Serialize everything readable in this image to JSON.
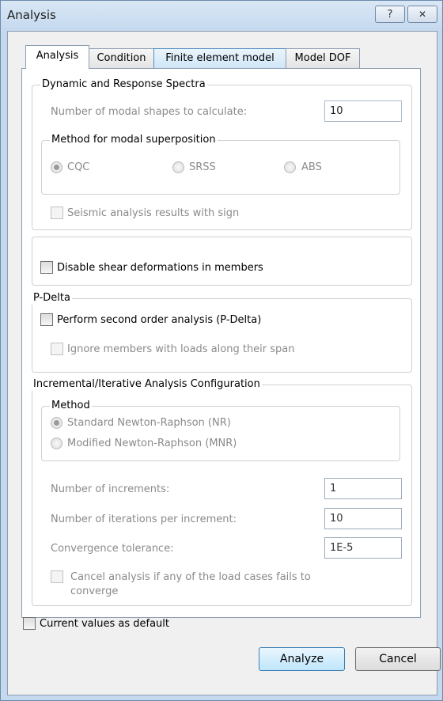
{
  "window": {
    "title": "Analysis",
    "help_label": "?",
    "close_label": "✕"
  },
  "tabs": [
    {
      "label": "Analysis"
    },
    {
      "label": "Condition"
    },
    {
      "label": "Finite element model"
    },
    {
      "label": "Model DOF"
    }
  ],
  "dynamic": {
    "group_label": "Dynamic and Response Spectra",
    "modal_shapes_label": "Number of modal shapes to calculate:",
    "modal_shapes_value": "10",
    "method_group_label": "Method for modal superposition",
    "methods": [
      "CQC",
      "SRSS",
      "ABS"
    ],
    "selected_method": "CQC",
    "seismic_sign_label": "Seismic analysis results with sign"
  },
  "shear": {
    "label": "Disable shear deformations in members"
  },
  "pdelta": {
    "group_label": "P-Delta",
    "perform_label": "Perform second order analysis (P-Delta)",
    "ignore_label": "Ignore members with loads along their span"
  },
  "incremental": {
    "group_label": "Incremental/Iterative Analysis Configuration",
    "method_group_label": "Method",
    "methods": [
      "Standard Newton-Raphson (NR)",
      "Modified Newton-Raphson (MNR)"
    ],
    "selected_method": "Standard Newton-Raphson (NR)",
    "increments_label": "Number of increments:",
    "increments_value": "1",
    "iterations_label": "Number of iterations per increment:",
    "iterations_value": "10",
    "tolerance_label": "Convergence tolerance:",
    "tolerance_value": "1E-5",
    "cancel_label_line1": "Cancel analysis if any of the load cases fails to",
    "cancel_label_line2": "converge"
  },
  "footer": {
    "default_label": "Current values as default",
    "analyze_label": "Analyze",
    "cancel_label": "Cancel"
  }
}
